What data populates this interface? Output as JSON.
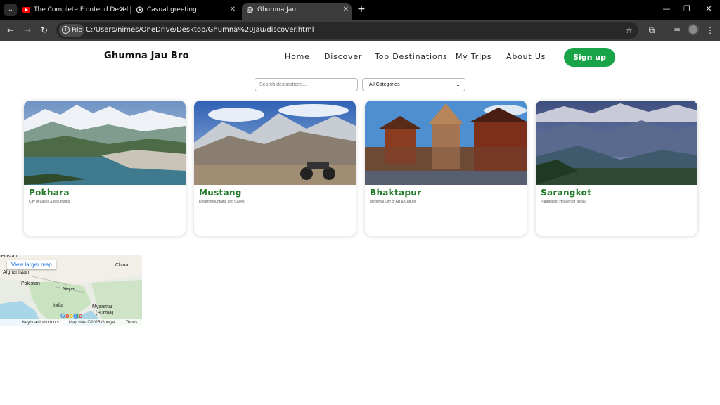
{
  "browser": {
    "tabs": [
      {
        "title": "The Complete Frontend Develo",
        "icon": "youtube-icon"
      },
      {
        "title": "Casual greeting",
        "icon": "chatgpt-icon"
      },
      {
        "title": "Ghumna Jau",
        "icon": "globe-icon"
      }
    ],
    "new_tab": "+",
    "chip_label": "File",
    "url": "C:/Users/nimes/OneDrive/Desktop/Ghumna%20Jau/discover.html"
  },
  "site": {
    "brand": "Ghumna Jau Bro",
    "nav": [
      "Home",
      "Discover",
      "Top Destinations",
      "My Trips",
      "About Us"
    ],
    "signup": "Sign up",
    "accent": "#1aa44a",
    "title_color": "#237a2a"
  },
  "filters": {
    "search_placeholder": "Search destinations...",
    "category": "All Categories"
  },
  "destinations": [
    {
      "name": "Pokhara",
      "subtitle": "City of Lakes & Mountains"
    },
    {
      "name": "Mustang",
      "subtitle": "Desert Mountains and Caves"
    },
    {
      "name": "Bhaktapur",
      "subtitle": "Medieval City of Art & Culture"
    },
    {
      "name": "Sarangkot",
      "subtitle": "Paragliding Heaven of Nepal"
    }
  ],
  "map": {
    "view_larger": "View larger map",
    "labels": {
      "afghanistan": "Afghanistan",
      "pakistan": "Pakistan",
      "china": "China",
      "nepal": "Nepal",
      "india": "India",
      "myanmar": "Myanmar",
      "burma": "(Burma)",
      "stan": "nenistan"
    },
    "google": "Google",
    "footer": {
      "shortcuts": "Keyboard shortcuts",
      "data": "Map data ©2025 Google",
      "terms": "Terms"
    }
  }
}
